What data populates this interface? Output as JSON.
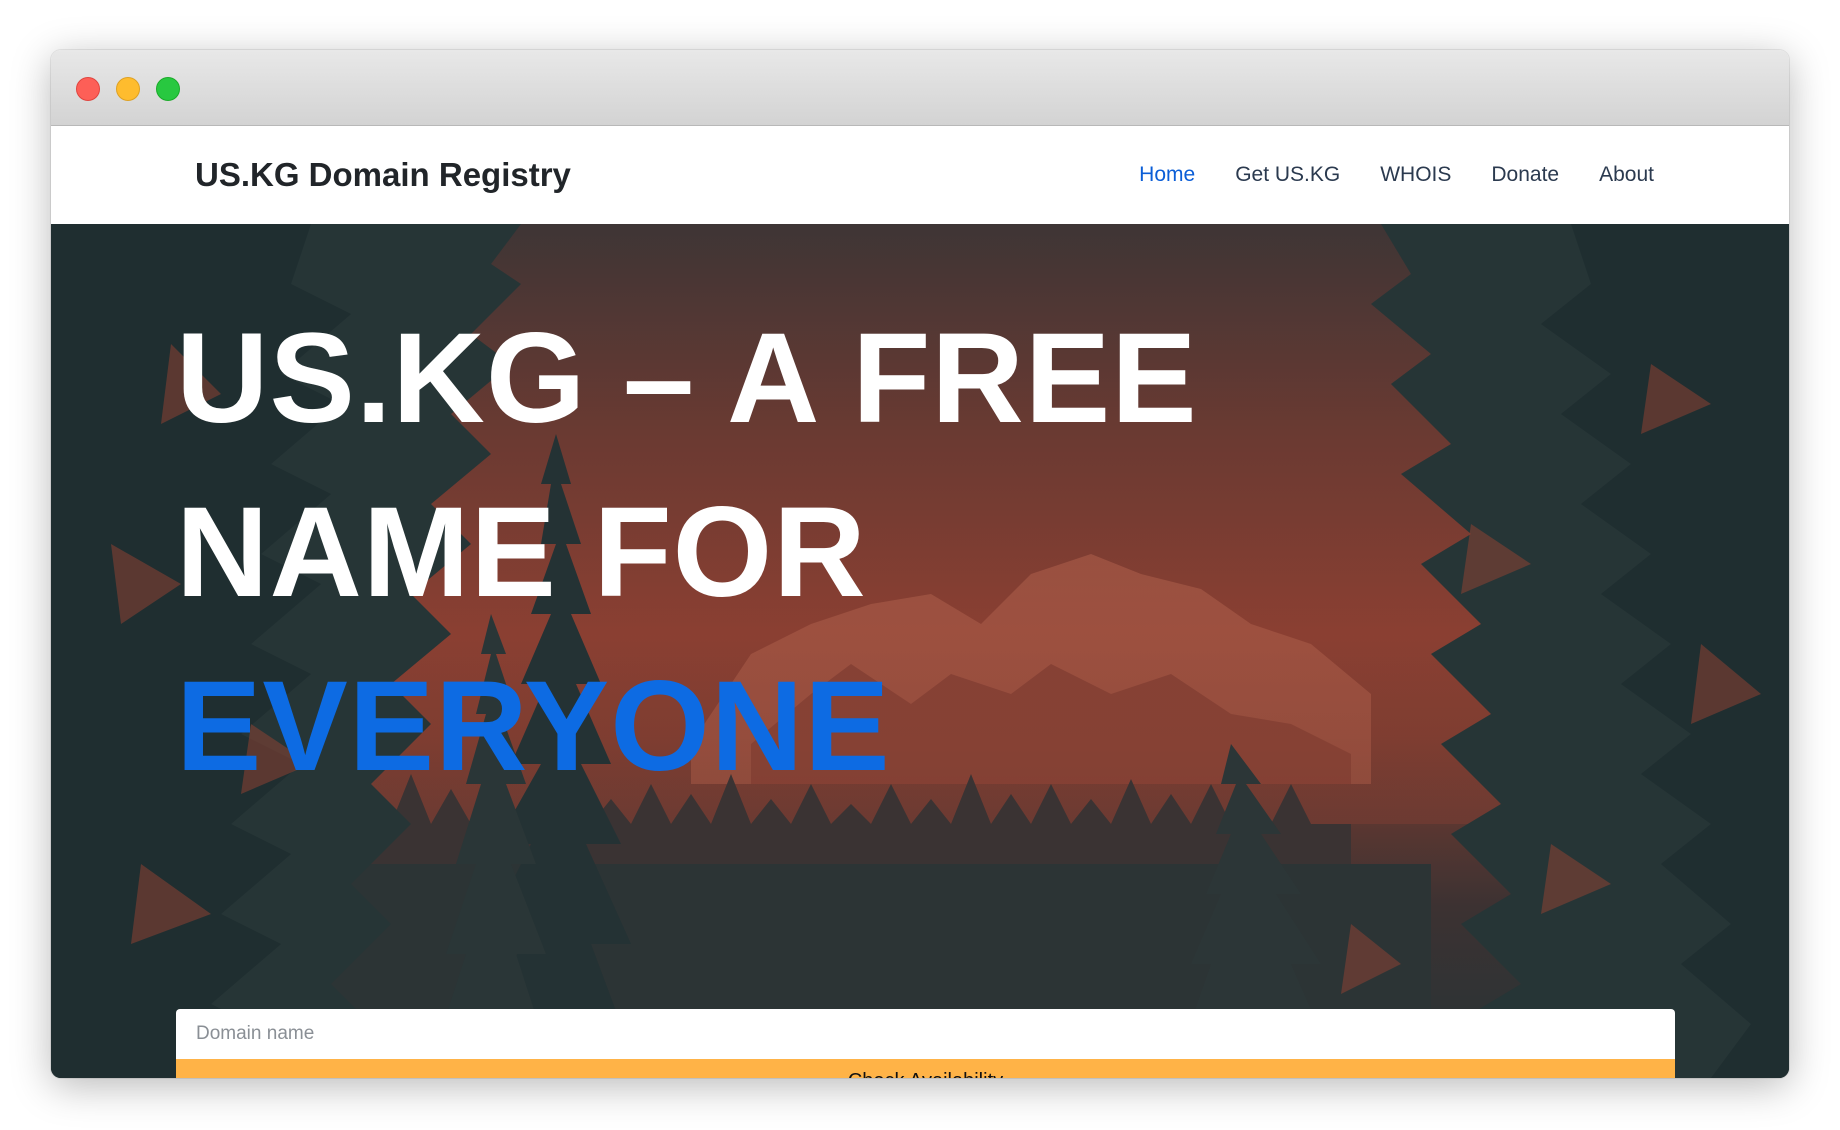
{
  "window": {
    "controls": [
      "close",
      "minimize",
      "zoom"
    ]
  },
  "navbar": {
    "brand": "US.KG Domain Registry",
    "links": [
      {
        "label": "Home",
        "active": true
      },
      {
        "label": "Get US.KG",
        "active": false
      },
      {
        "label": "WHOIS",
        "active": false
      },
      {
        "label": "Donate",
        "active": false
      },
      {
        "label": "About",
        "active": false
      }
    ]
  },
  "hero": {
    "headline_line1": "US.KG – A FREE",
    "headline_line2": "NAME FOR",
    "headline_accent": "EVERYONE",
    "accent_color": "#0d6be3",
    "background": "forest-mountain-duotone"
  },
  "search": {
    "placeholder": "Domain name",
    "value": "",
    "button_label": "Check Availability",
    "button_color": "#ffb347"
  },
  "colors": {
    "nav_active": "#0b5ed7",
    "hero_tint": "#8a3f32",
    "tree_dark": "#243538"
  }
}
